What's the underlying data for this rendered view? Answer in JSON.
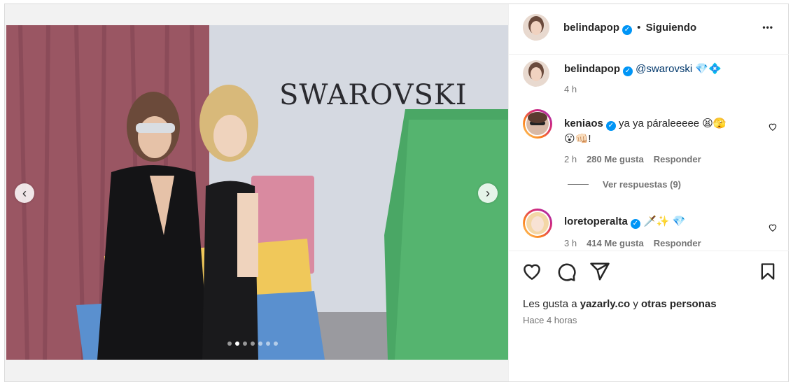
{
  "post": {
    "author": "belindapop",
    "follow_sep": "•",
    "follow_status": "Siguiendo",
    "more": "•••"
  },
  "caption": {
    "author": "belindapop",
    "mention": "@swarovski",
    "emojis": "💎💠",
    "time": "4 h"
  },
  "comments": [
    {
      "author": "keniaos",
      "text_line1": "ya ya páraleeeee 😫🫣",
      "text_line2": "😮👊🏻!",
      "time": "2 h",
      "likes": "280 Me gusta",
      "reply": "Responder"
    },
    {
      "author": "loretoperalta",
      "text_line1": "🗡️✨ 💎",
      "time": "3 h",
      "likes": "414 Me gusta",
      "reply": "Responder"
    }
  ],
  "view_replies": "Ver respuestas (9)",
  "likes": {
    "prefix": "Les gusta a",
    "user": "yazarly.co",
    "joiner": "y",
    "others": "otras personas"
  },
  "posted_ago": "Hace 4 horas",
  "image": {
    "brand_text": "SWAROVSKI",
    "slide_count": 7,
    "active_slide": 2
  },
  "icons": {
    "prev": "chevron-left-icon",
    "next": "chevron-right-icon",
    "like": "heart-icon",
    "comment": "comment-icon",
    "share": "send-icon",
    "save": "bookmark-icon",
    "verified": "verified-badge-icon"
  },
  "colors": {
    "verified": "#0095f6",
    "text": "#262626",
    "muted": "#737373",
    "border": "#dbdbdb"
  }
}
